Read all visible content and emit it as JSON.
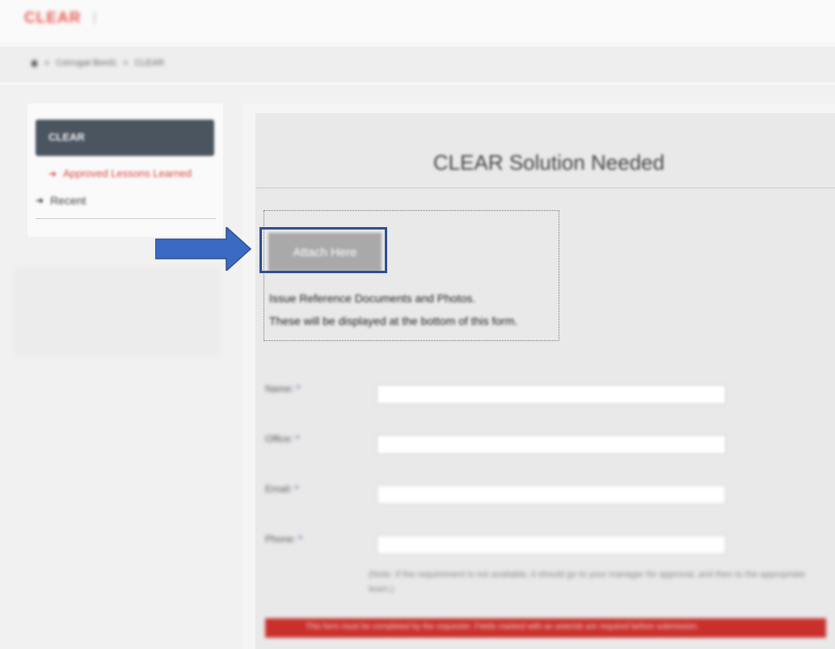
{
  "app": {
    "logo_text": "CLEAR",
    "logo_separator": "|"
  },
  "breadcrumb": {
    "home_icon": "home-icon",
    "items": [
      "»",
      "Corrugat Bord1",
      "»",
      "CLEAR"
    ]
  },
  "sidebar": {
    "header": "CLEAR",
    "items": [
      {
        "label": "Approved Lessons Learned",
        "icon": "arrow-right-icon",
        "color": "#d94a40"
      },
      {
        "label": "Recent",
        "icon": "arrow-right-icon",
        "color": "#333333"
      }
    ]
  },
  "main": {
    "title": "CLEAR Solution Needed",
    "attachment": {
      "button_label": "Attach Here",
      "line1": "Issue Reference Documents and Photos.",
      "line2": "These will be displayed at the bottom of this form."
    },
    "form": {
      "fields": [
        {
          "label": "Name:",
          "required_mark": "*",
          "value": ""
        },
        {
          "label": "Office:",
          "required_mark": "*",
          "value": ""
        },
        {
          "label": "Email:",
          "required_mark": "*",
          "value": ""
        },
        {
          "label": "Phone:",
          "required_mark": "*",
          "value": ""
        }
      ],
      "help_text": "(Note: If the requirement is not available, it should go to your manager for approval, and then to the appropriate team.)",
      "bottom_bar_text": "This form must be completed by the requester. Fields marked with an asterisk are required before submission."
    }
  },
  "annotation": {
    "pointer_color": "#3a6bc4",
    "highlight_color": "#2c4f8c"
  }
}
